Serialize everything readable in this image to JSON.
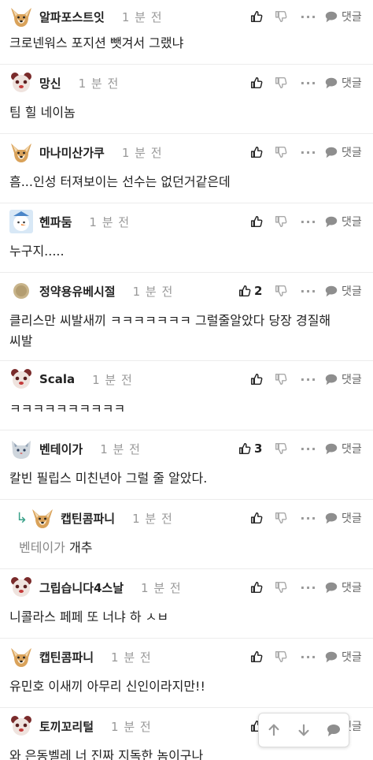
{
  "time_label": "1 분 전",
  "reply_label": "댓글",
  "more_label": "···",
  "comments": [
    {
      "nick": "알파포스트잇",
      "avatar": "dog-avatar",
      "text": "크로넨워스 포지션 뺏겨서 그랬냐",
      "likes": ""
    },
    {
      "nick": "망신",
      "avatar": "bear-avatar",
      "text": "팀 힐 네이놈",
      "likes": ""
    },
    {
      "nick": "마나미산가쿠",
      "avatar": "dog-avatar",
      "text": "흠...인성 터져보이는 선수는 없던거같은데",
      "likes": ""
    },
    {
      "nick": "헨파둠",
      "avatar": "snowman-avatar",
      "text": "누구지.....",
      "likes": ""
    },
    {
      "nick": "정약용유베시절",
      "avatar": "beige-circle-avatar",
      "text": "클리스만 씨발새끼 ㅋㅋㅋㅋㅋㅋㅋ 그럴줄알았다 당장 경질해\n씨발",
      "likes": "2"
    },
    {
      "nick": "Scala",
      "avatar": "bear-avatar",
      "text": "ㅋㅋㅋㅋㅋㅋㅋㅋㅋㅋ",
      "likes": ""
    },
    {
      "nick": "벤테이가",
      "avatar": "cat-avatar",
      "text": "칼빈 필립스 미친년아 그럴 줄 알았다.",
      "likes": "3"
    },
    {
      "nick": "캡틴콤파니",
      "avatar": "dog-avatar",
      "mention": "벤테이가",
      "text": "개추",
      "likes": ""
    },
    {
      "nick": "그립습니다4스날",
      "avatar": "bear-avatar",
      "text": "니콜라스 페페 또 너냐 하 ㅅㅂ",
      "likes": ""
    },
    {
      "nick": "캡틴콤파니",
      "avatar": "dog-avatar",
      "text": "유민호 이새끼 아무리 신인이라지만!!",
      "likes": ""
    },
    {
      "nick": "토끼꼬리털",
      "avatar": "bear-avatar",
      "text": "와 은동벨레 너 진짜 지독한 놈이구나",
      "likes": ""
    }
  ],
  "fab": {
    "up_icon": "arrow-up-icon",
    "down_icon": "arrow-down-icon",
    "comment_icon": "speech-bubble-icon"
  },
  "colors": {
    "reply_arrow": "#3aa18a",
    "muted": "#999999"
  }
}
